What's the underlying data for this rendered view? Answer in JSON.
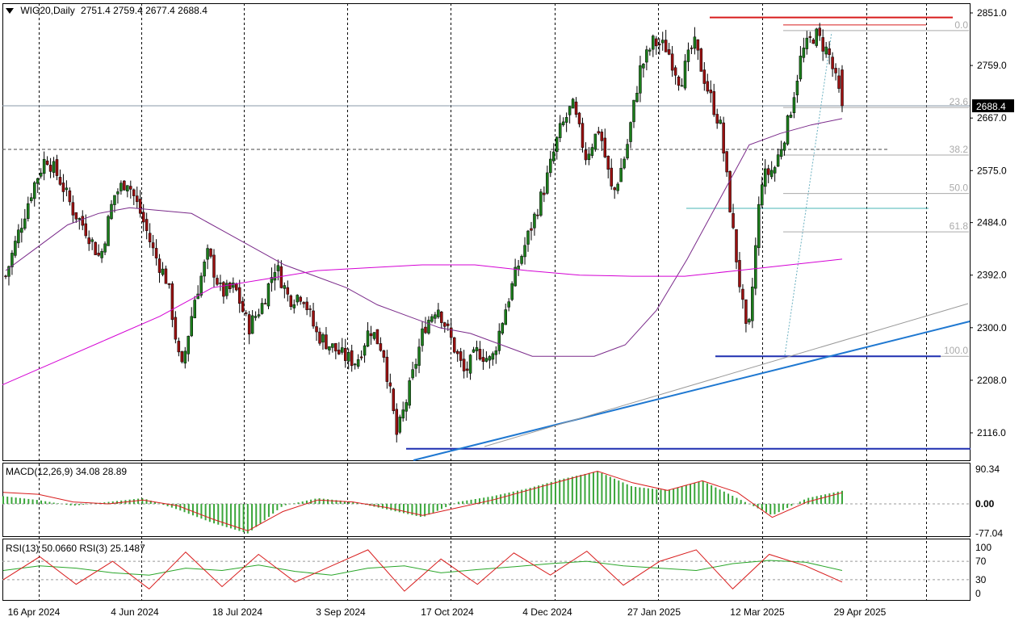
{
  "header": {
    "symbol": "WIG20,Daily",
    "ohlc": "2751.4 2759.4 2677.4 2688.4",
    "collapse_icon": "triangle-down-icon"
  },
  "macd": {
    "label": "MACD(12,26,9) 34.08 28.89",
    "scale": [
      "90.34",
      "0.00",
      "-77.04"
    ]
  },
  "rsi": {
    "label": "RSI(13) 50.0660  RSI(3) 25.1487",
    "scale": [
      "100",
      "70",
      "30",
      "0"
    ]
  },
  "x_labels": [
    "16 Apr 2024",
    "4 Jun 2024",
    "18 Jul 2024",
    "3 Sep 2024",
    "17 Oct 2024",
    "4 Dec 2024",
    "27 Jan 2025",
    "12 Mar 2025",
    "29 Apr 2025"
  ],
  "price_axis": [
    "2851.0",
    "2759.0",
    "2667.0",
    "2575.0",
    "2484.0",
    "2392.0",
    "2300.0",
    "2208.0",
    "2116.0"
  ],
  "current_price": "2688.4",
  "fib_levels": [
    "0.0",
    "23.6",
    "38.2",
    "50.0",
    "61.8",
    "100.0"
  ],
  "colors": {
    "bull": "#1b7d1b",
    "bear": "#9a1010",
    "ma_short": "#7a2a8a",
    "ma_long": "#d400d4",
    "trend": "#1f78d1",
    "support": "#1f2fb0",
    "resistance": "#d81c1c",
    "macd_hist": "#3aa63a",
    "macd_signal": "#d81c1c",
    "rsi_fast": "#d81c1c",
    "rsi_slow": "#2aa62a"
  },
  "chart_data": {
    "type": "candlestick",
    "title": "WIG20,Daily",
    "ylim": [
      2080,
      2870
    ],
    "x": [
      "16 Apr 2024",
      "4 Jun 2024",
      "18 Jul 2024",
      "3 Sep 2024",
      "17 Oct 2024",
      "4 Dec 2024",
      "27 Jan 2025",
      "12 Mar 2025",
      "29 Apr 2025"
    ],
    "close_path": [
      2390,
      2470,
      2545,
      2600,
      2560,
      2505,
      2470,
      2420,
      2530,
      2560,
      2500,
      2430,
      2380,
      2220,
      2350,
      2430,
      2360,
      2370,
      2300,
      2340,
      2410,
      2350,
      2360,
      2290,
      2270,
      2250,
      2240,
      2300,
      2260,
      2110,
      2200,
      2300,
      2340,
      2280,
      2220,
      2260,
      2240,
      2330,
      2410,
      2480,
      2550,
      2640,
      2690,
      2600,
      2650,
      2530,
      2610,
      2750,
      2800,
      2790,
      2730,
      2800,
      2720,
      2650,
      2450,
      2270,
      2560,
      2580,
      2660,
      2780,
      2815,
      2780,
      2688
    ],
    "last_ohlc": {
      "open": 2751.4,
      "high": 2759.4,
      "low": 2677.4,
      "close": 2688.4
    },
    "ma_short": [
      2400,
      2440,
      2480,
      2500,
      2510,
      2505,
      2500,
      2470,
      2440,
      2410,
      2390,
      2370,
      2340,
      2320,
      2300,
      2290,
      2270,
      2250,
      2250,
      2250,
      2270,
      2330,
      2420,
      2520,
      2620,
      2640,
      2655,
      2666
    ],
    "ma_long": [
      2200,
      2240,
      2280,
      2320,
      2370,
      2385,
      2400,
      2405,
      2410,
      2410,
      2400,
      2392,
      2390,
      2390,
      2400,
      2410,
      2420
    ],
    "fib": {
      "high": 2820,
      "low": 2250
    },
    "macd": {
      "line": [
        40,
        20,
        -10,
        0,
        20,
        -20,
        -60,
        -77,
        -10,
        20,
        0,
        -20,
        -40,
        0,
        20,
        40,
        70,
        90,
        50,
        30,
        70,
        20,
        -40,
        10,
        35
      ],
      "hist": [
        20,
        10,
        -5,
        5,
        15,
        -15,
        -50,
        -77,
        -5,
        15,
        5,
        -15,
        -35,
        5,
        20,
        40,
        65,
        85,
        45,
        35,
        60,
        15,
        -30,
        15,
        34
      ],
      "signal": [
        30,
        25,
        5,
        0,
        10,
        -5,
        -40,
        -70,
        -20,
        10,
        5,
        -10,
        -30,
        -10,
        10,
        35,
        60,
        85,
        55,
        35,
        60,
        30,
        -35,
        5,
        29
      ]
    },
    "rsi": {
      "rsi13": [
        50,
        60,
        55,
        45,
        40,
        55,
        50,
        62,
        48,
        40,
        55,
        60,
        45,
        52,
        58,
        65,
        70,
        60,
        55,
        50,
        65,
        72,
        68,
        50
      ],
      "rsi3": [
        30,
        80,
        20,
        70,
        10,
        90,
        15,
        85,
        25,
        60,
        95,
        5,
        75,
        20,
        88,
        40,
        92,
        18,
        70,
        95,
        10,
        85,
        60,
        25
      ]
    }
  }
}
